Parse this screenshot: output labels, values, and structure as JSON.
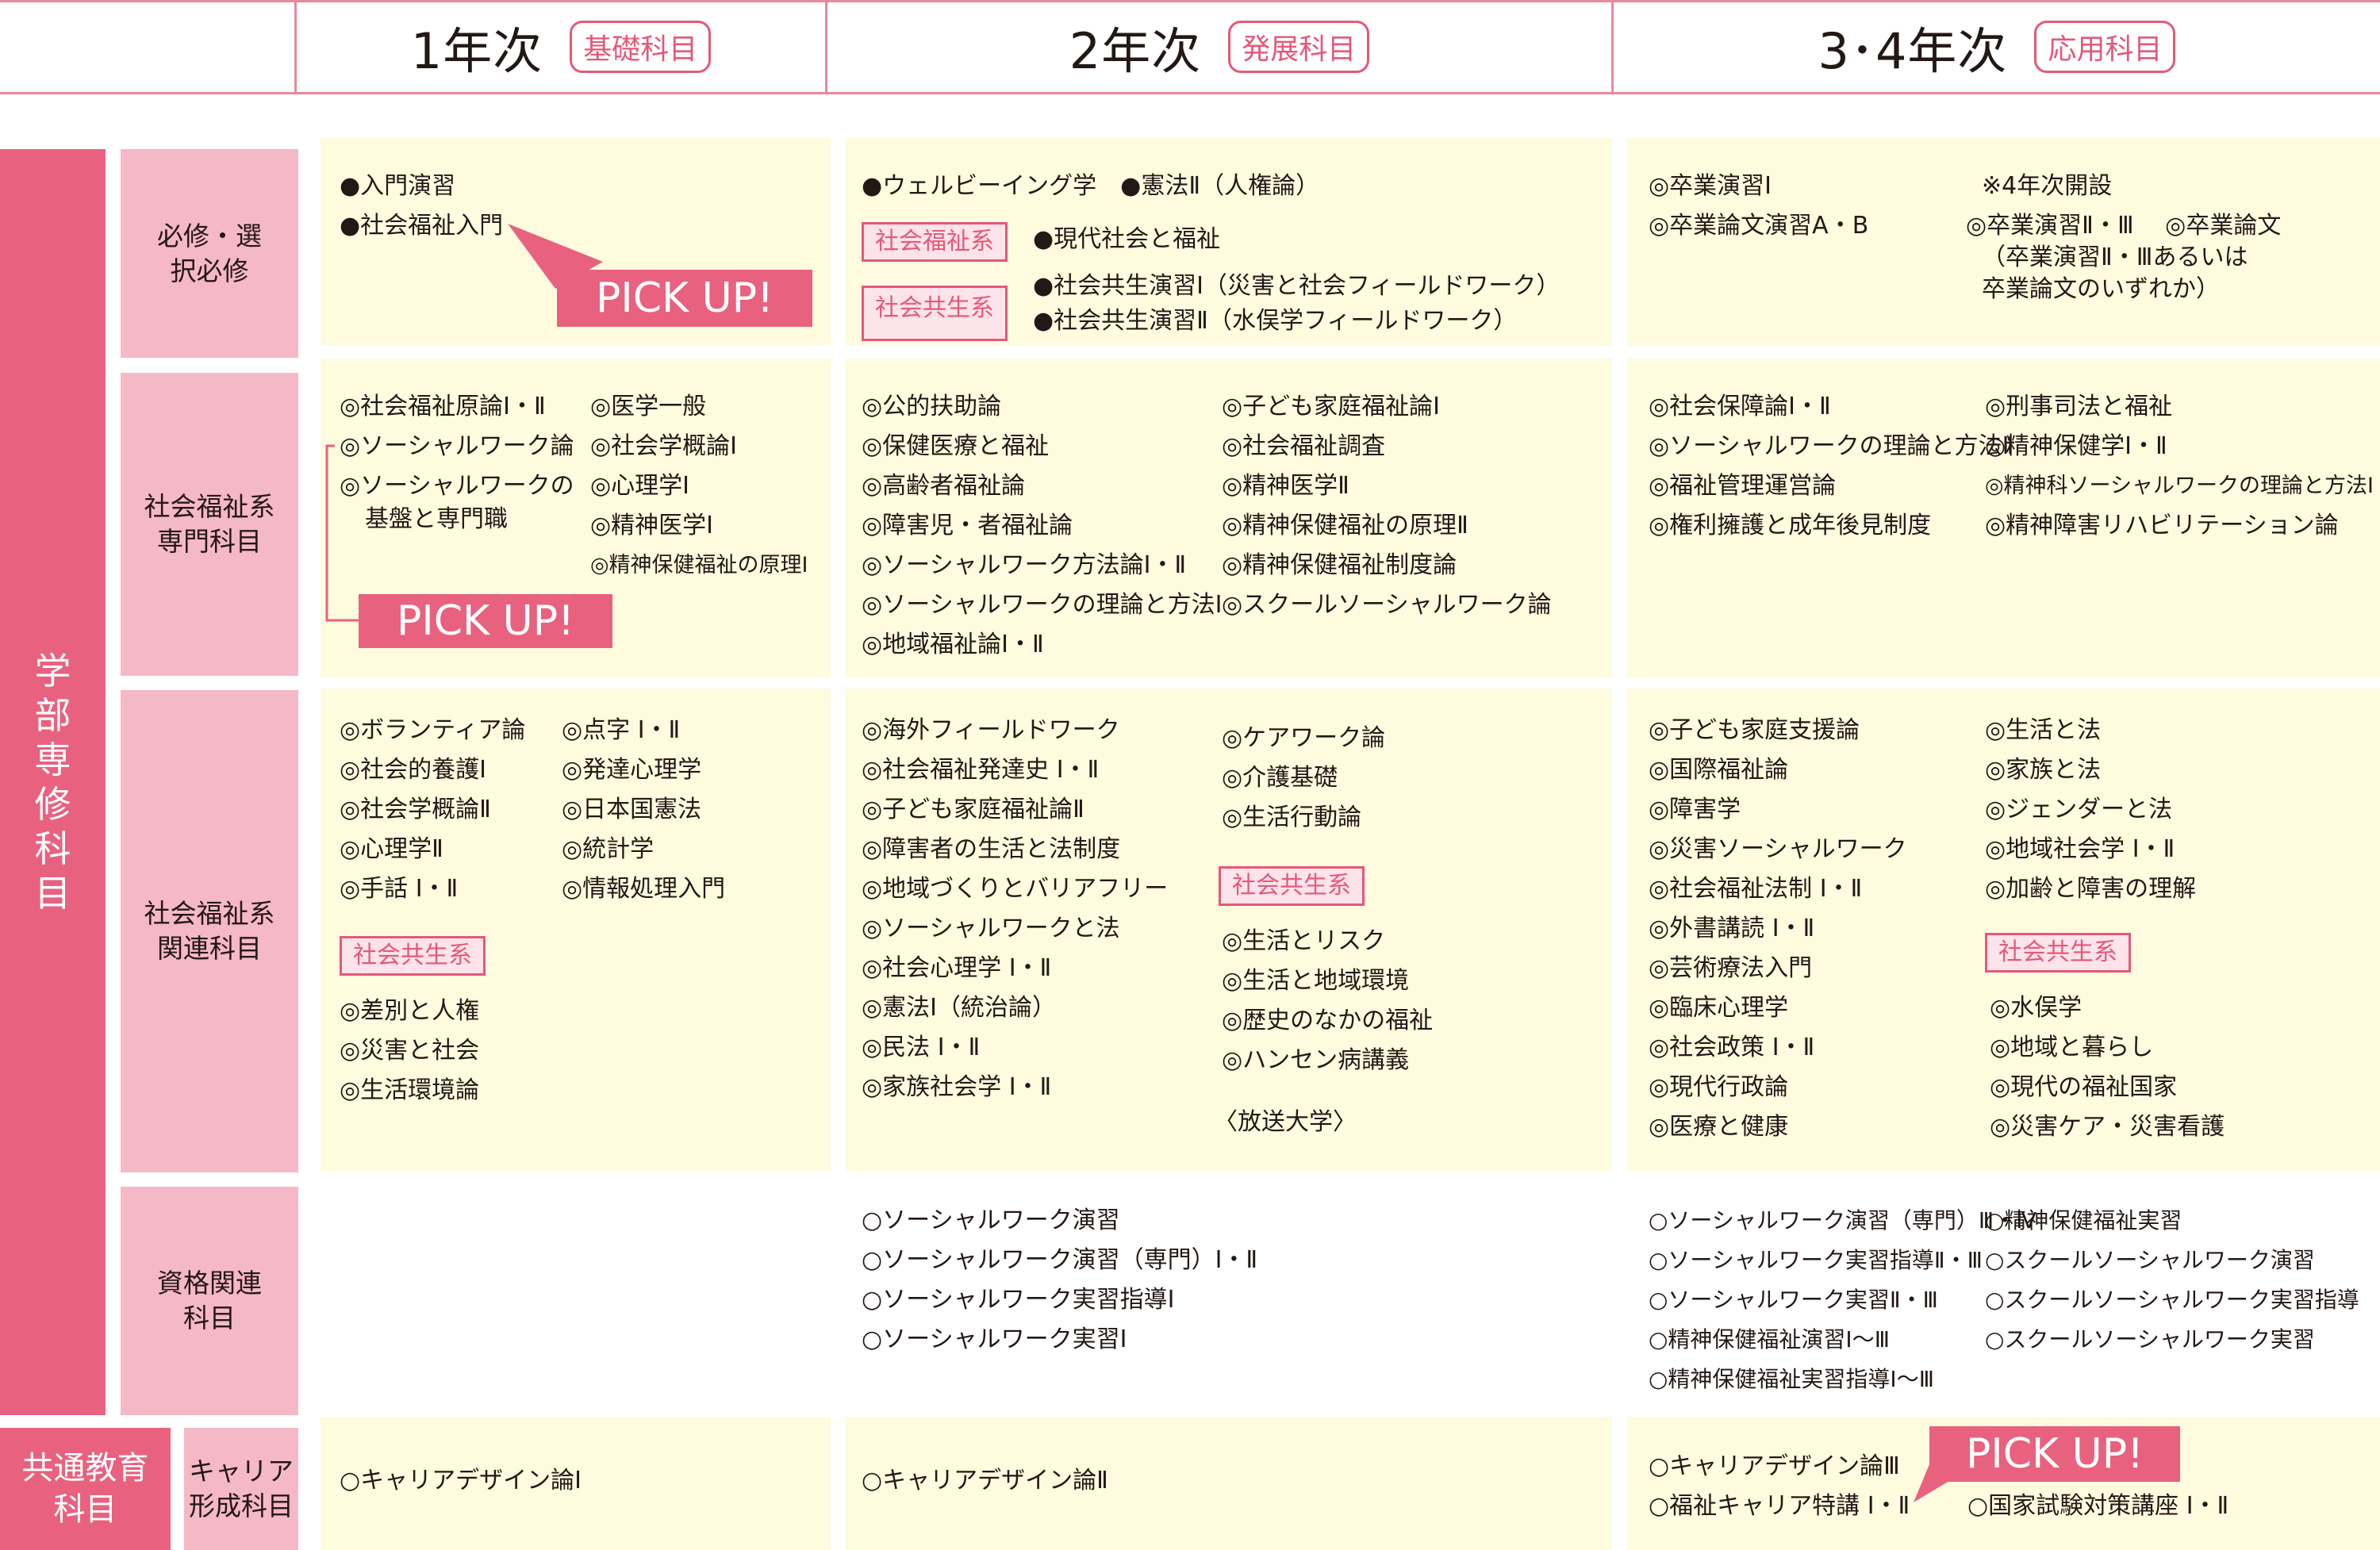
{
  "header": {
    "year1": "1年次",
    "tag1": "基礎科目",
    "year2": "2年次",
    "tag2": "発展科目",
    "year3": "3･4年次",
    "tag3": "応用科目"
  },
  "sidebar": {
    "faculty": "学部専修科目",
    "common": "共通教育科目",
    "row1": "必修・選択必修",
    "row2": "社会福祉系専門科目",
    "row3": "社会福祉系関連科目",
    "row4": "資格関連科目",
    "row5": "キャリア形成科目"
  },
  "pickup": "PICK UP!",
  "tags": {
    "fukushi": "社会福祉系",
    "kyosei": "社会共生系"
  },
  "cells": {
    "r1y1": [
      "●入門演習",
      "●社会福祉入門"
    ],
    "r1y2": [
      "●ウェルビーイング学　●憲法Ⅱ（人権論）",
      "●現代社会と福祉",
      "●社会共生演習Ⅰ（災害と社会フィールドワーク）",
      "●社会共生演習Ⅱ（水俣学フィールドワーク）"
    ],
    "r1y3a": [
      "◎卒業演習Ⅰ",
      "◎卒業論文演習A・B"
    ],
    "r1y3b": [
      "※4年次開設",
      "◎卒業演習Ⅱ・Ⅲ　 ◎卒業論文",
      "（卒業演習Ⅱ・Ⅲあるいは",
      "卒業論文のいずれか）"
    ],
    "r2y1a": [
      "◎社会福祉原論Ⅰ・Ⅱ",
      "◎ソーシャルワーク論",
      "◎ソーシャルワークの",
      "基盤と専門職"
    ],
    "r2y1b": [
      "◎医学一般",
      "◎社会学概論Ⅰ",
      "◎心理学Ⅰ",
      "◎精神医学Ⅰ",
      "◎精神保健福祉の原理Ⅰ"
    ],
    "r2y2a": [
      "◎公的扶助論",
      "◎保健医療と福祉",
      "◎高齢者福祉論",
      "◎障害児・者福祉論",
      "◎ソーシャルワーク方法論Ⅰ・Ⅱ",
      "◎ソーシャルワークの理論と方法Ⅰ",
      "◎地域福祉論Ⅰ・Ⅱ"
    ],
    "r2y2b": [
      "◎子ども家庭福祉論Ⅰ",
      "◎社会福祉調査",
      "◎精神医学Ⅱ",
      "◎精神保健福祉の原理Ⅱ",
      "◎精神保健福祉制度論",
      "◎スクールソーシャルワーク論"
    ],
    "r2y3a": [
      "◎社会保障論Ⅰ・Ⅱ",
      "◎ソーシャルワークの理論と方法Ⅱ",
      "◎福祉管理運営論",
      "◎権利擁護と成年後見制度"
    ],
    "r2y3b": [
      "◎刑事司法と福祉",
      "◎精神保健学Ⅰ・Ⅱ",
      "◎精神科ソーシャルワークの理論と方法Ⅰ・Ⅱ",
      "◎精神障害リハビリテーション論"
    ],
    "r3y1a": [
      "◎ボランティア論",
      "◎社会的養護Ⅰ",
      "◎社会学概論Ⅱ",
      "◎心理学Ⅱ",
      "◎手話 Ⅰ・Ⅱ"
    ],
    "r3y1b": [
      "◎点字 Ⅰ・Ⅱ",
      "◎発達心理学",
      "◎日本国憲法",
      "◎統計学",
      "◎情報処理入門"
    ],
    "r3y1c": [
      "◎差別と人権",
      "◎災害と社会",
      "◎生活環境論"
    ],
    "r3y2a": [
      "◎海外フィールドワーク",
      "◎社会福祉発達史 Ⅰ・Ⅱ",
      "◎子ども家庭福祉論Ⅱ",
      "◎障害者の生活と法制度",
      "◎地域づくりとバリアフリー",
      "◎ソーシャルワークと法",
      "◎社会心理学 Ⅰ・Ⅱ",
      "◎憲法Ⅰ（統治論）",
      "◎民法 Ⅰ・Ⅱ",
      "◎家族社会学 Ⅰ・Ⅱ"
    ],
    "r3y2b": [
      "◎ケアワーク論",
      "◎介護基礎",
      "◎生活行動論"
    ],
    "r3y2c": [
      "◎生活とリスク",
      "◎生活と地域環境",
      "◎歴史のなかの福祉",
      "◎ハンセン病講義"
    ],
    "r3y2d": "〈放送大学〉",
    "r3y3a": [
      "◎子ども家庭支援論",
      "◎国際福祉論",
      "◎障害学",
      "◎災害ソーシャルワーク",
      "◎社会福祉法制 Ⅰ・Ⅱ",
      "◎外書講読 Ⅰ・Ⅱ",
      "◎芸術療法入門",
      "◎臨床心理学",
      "◎社会政策 Ⅰ・Ⅱ",
      "◎現代行政論",
      "◎医療と健康"
    ],
    "r3y3b": [
      "◎生活と法",
      "◎家族と法",
      "◎ジェンダーと法",
      "◎地域社会学 Ⅰ・Ⅱ",
      "◎加齢と障害の理解"
    ],
    "r3y3c": [
      "◎水俣学",
      "◎地域と暮らし",
      "◎現代の福祉国家",
      "◎災害ケア・災害看護"
    ],
    "r4y2": [
      "○ソーシャルワーク演習",
      "○ソーシャルワーク演習（専門）Ⅰ・Ⅱ",
      "○ソーシャルワーク実習指導Ⅰ",
      "○ソーシャルワーク実習Ⅰ"
    ],
    "r4y3a": [
      "○ソーシャルワーク演習（専門）Ⅲ・Ⅳ",
      "○ソーシャルワーク実習指導Ⅱ・Ⅲ",
      "○ソーシャルワーク実習Ⅱ・Ⅲ",
      "○精神保健福祉演習Ⅰ〜Ⅲ",
      "○精神保健福祉実習指導Ⅰ〜Ⅲ"
    ],
    "r4y3b": [
      "○精神保健福祉実習",
      "○スクールソーシャルワーク演習",
      "○スクールソーシャルワーク実習指導",
      "○スクールソーシャルワーク実習"
    ],
    "r5y1": "○キャリアデザイン論Ⅰ",
    "r5y2": "○キャリアデザイン論Ⅱ",
    "r5y3a": [
      "○キャリアデザイン論Ⅲ",
      "○福祉キャリア特講 Ⅰ・Ⅱ"
    ],
    "r5y3b": "○国家試験対策講座 Ⅰ・Ⅱ"
  }
}
